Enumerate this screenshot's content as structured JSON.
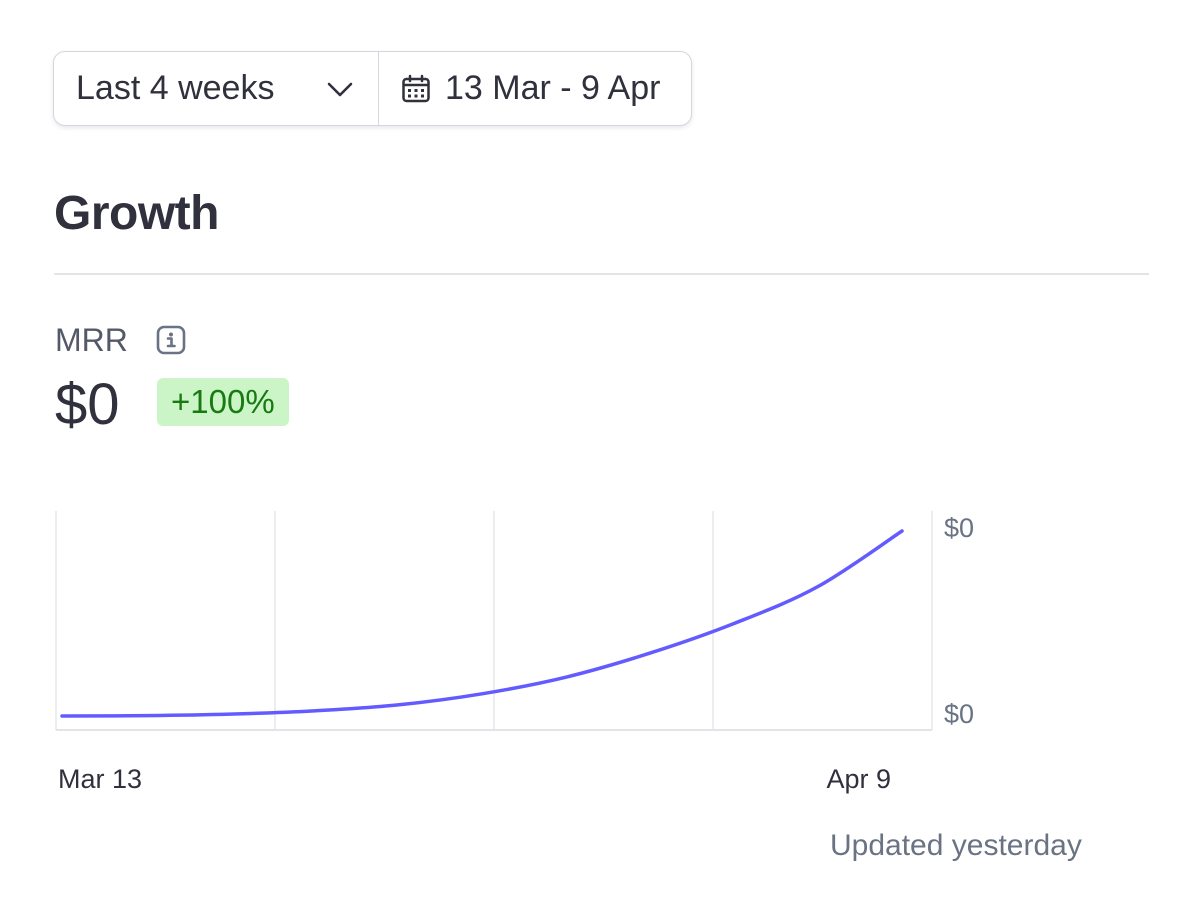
{
  "filters": {
    "period_label": "Last 4 weeks",
    "date_range_label": "13 Mar - 9 Apr",
    "icons": {
      "period": "chevron-down-icon",
      "date_range": "calendar-icon"
    }
  },
  "section": {
    "title": "Growth"
  },
  "metric": {
    "label": "MRR",
    "info_icon": "info-icon",
    "value": "$0",
    "change": "+100%"
  },
  "chart_data": {
    "type": "line",
    "x_labels": [
      "Mar 13",
      "Apr 9"
    ],
    "y_tick_labels": [
      "$0",
      "$0"
    ],
    "series": [
      {
        "values": [
          0,
          0.002,
          0.01,
          0.028,
          0.06,
          0.12,
          0.21,
          0.34,
          0.5,
          0.7,
          1.0
        ]
      }
    ],
    "ylim": [
      0,
      1
    ],
    "grid": "vertical",
    "line_color": "#635bff"
  },
  "footer": {
    "updated": "Updated yesterday"
  },
  "colors": {
    "accent": "#635bff",
    "badge_bg": "#cbf5c7",
    "badge_text": "#1a7a12",
    "border": "#d5d7de",
    "text_primary": "#30313d",
    "text_secondary": "#6a7383"
  }
}
